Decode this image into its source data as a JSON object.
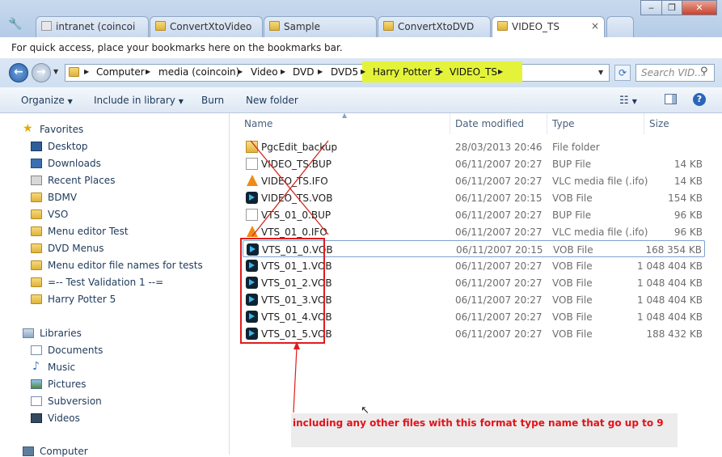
{
  "tabs": [
    {
      "label": "intranet (coincoi",
      "active": false
    },
    {
      "label": "ConvertXtoVideo",
      "active": false
    },
    {
      "label": "Sample",
      "active": false
    },
    {
      "label": "ConvertXtoDVD",
      "active": false
    },
    {
      "label": "VIDEO_TS",
      "active": true
    }
  ],
  "bookmarks_bar": {
    "text": "For quick access, place your bookmarks here on the bookmarks bar."
  },
  "breadcrumb": [
    "Computer",
    "media (coincoin)",
    "Video",
    "DVD",
    "DVD5",
    "Harry Potter 5",
    "VIDEO_TS"
  ],
  "search": {
    "placeholder": "Search VID..."
  },
  "toolbar": {
    "organize": "Organize",
    "include": "Include in library",
    "burn": "Burn",
    "new_folder": "New folder"
  },
  "nav": {
    "favorites_title": "Favorites",
    "favorites": [
      "Desktop",
      "Downloads",
      "Recent Places",
      "BDMV",
      "VSO",
      "Menu editor Test",
      "DVD Menus",
      "Menu editor file names for tests",
      "=-- Test Validation 1 --=",
      "Harry Potter 5"
    ],
    "libraries_title": "Libraries",
    "libraries": [
      "Documents",
      "Music",
      "Pictures",
      "Subversion",
      "Videos"
    ],
    "computer": "Computer"
  },
  "columns": {
    "name": "Name",
    "date": "Date modified",
    "type": "Type",
    "size": "Size"
  },
  "files": [
    {
      "name": "PgcEdit_backup",
      "date": "28/03/2013 20:46",
      "type": "File folder",
      "size": "",
      "icon": "folder"
    },
    {
      "name": "VIDEO_TS.BUP",
      "date": "06/11/2007 20:27",
      "type": "BUP File",
      "size": "14 KB",
      "icon": "file"
    },
    {
      "name": "VIDEO_TS.IFO",
      "date": "06/11/2007 20:27",
      "type": "VLC media file (.ifo)",
      "size": "14 KB",
      "icon": "vlc"
    },
    {
      "name": "VIDEO_TS.VOB",
      "date": "06/11/2007 20:15",
      "type": "VOB File",
      "size": "154 KB",
      "icon": "vob"
    },
    {
      "name": "VTS_01_0.BUP",
      "date": "06/11/2007 20:27",
      "type": "BUP File",
      "size": "96 KB",
      "icon": "file"
    },
    {
      "name": "VTS_01_0.IFO",
      "date": "06/11/2007 20:27",
      "type": "VLC media file (.ifo)",
      "size": "96 KB",
      "icon": "vlc"
    },
    {
      "name": "VTS_01_0.VOB",
      "date": "06/11/2007 20:15",
      "type": "VOB File",
      "size": "168 354 KB",
      "icon": "vob"
    },
    {
      "name": "VTS_01_1.VOB",
      "date": "06/11/2007 20:27",
      "type": "VOB File",
      "size": "1 048 404 KB",
      "icon": "vob"
    },
    {
      "name": "VTS_01_2.VOB",
      "date": "06/11/2007 20:27",
      "type": "VOB File",
      "size": "1 048 404 KB",
      "icon": "vob"
    },
    {
      "name": "VTS_01_3.VOB",
      "date": "06/11/2007 20:27",
      "type": "VOB File",
      "size": "1 048 404 KB",
      "icon": "vob"
    },
    {
      "name": "VTS_01_4.VOB",
      "date": "06/11/2007 20:27",
      "type": "VOB File",
      "size": "1 048 404 KB",
      "icon": "vob"
    },
    {
      "name": "VTS_01_5.VOB",
      "date": "06/11/2007 20:27",
      "type": "VOB File",
      "size": "188 432 KB",
      "icon": "vob"
    }
  ],
  "annotation": "including any other files with this format type name that go up to 9",
  "colors": {
    "highlight": "#e4f33a",
    "annotation_red": "#e3121a"
  }
}
